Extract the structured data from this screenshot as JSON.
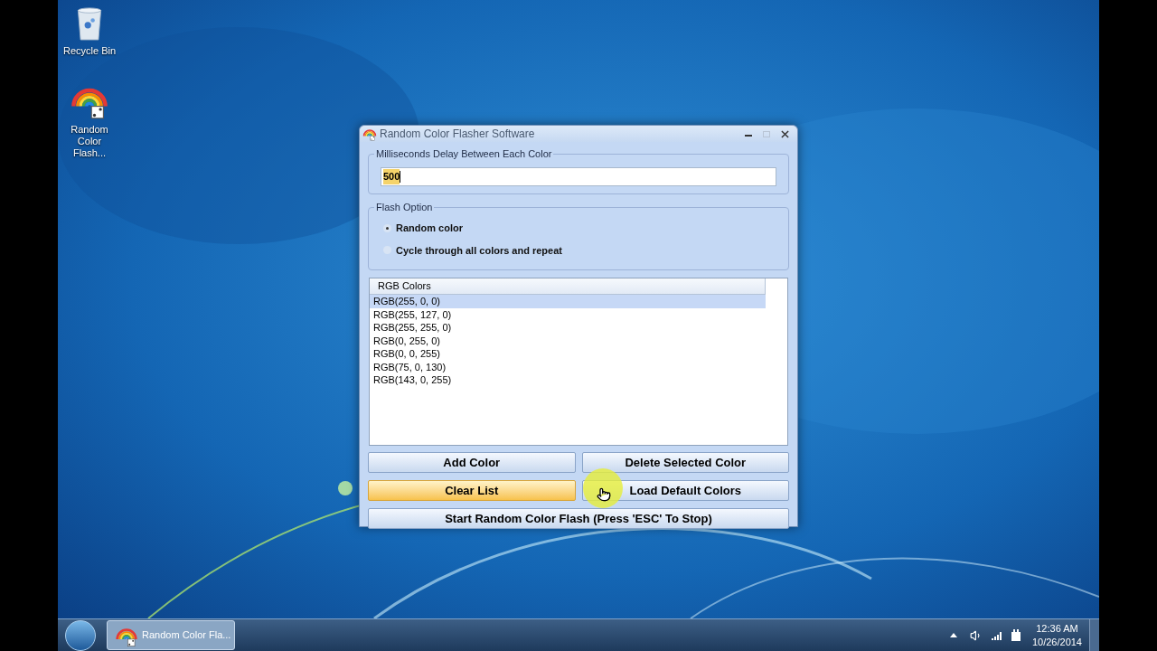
{
  "desktop_icons": [
    {
      "label": "Recycle Bin",
      "kind": "recycle"
    },
    {
      "label": "Random Color Flash...",
      "kind": "app"
    }
  ],
  "window": {
    "title": "Random Color Flasher Software",
    "delay_group": {
      "legend": "Milliseconds Delay Between Each Color",
      "value": "500"
    },
    "flash_option": {
      "legend": "Flash Option",
      "options": [
        {
          "label": "Random color",
          "selected": true
        },
        {
          "label": "Cycle through all colors and repeat",
          "selected": false
        }
      ]
    },
    "list": {
      "column": "RGB Colors",
      "rows": [
        {
          "text": "RGB(255, 0, 0)",
          "selected": true
        },
        {
          "text": "RGB(255, 127, 0)",
          "selected": false
        },
        {
          "text": "RGB(255, 255, 0)",
          "selected": false
        },
        {
          "text": "RGB(0, 255, 0)",
          "selected": false
        },
        {
          "text": "RGB(0, 0, 255)",
          "selected": false
        },
        {
          "text": "RGB(75, 0, 130)",
          "selected": false
        },
        {
          "text": "RGB(143, 0, 255)",
          "selected": false
        }
      ]
    },
    "buttons": [
      {
        "label": "Add Color",
        "hovered": false
      },
      {
        "label": "Delete Selected Color",
        "hovered": false
      },
      {
        "label": "Clear List",
        "hovered": true
      },
      {
        "label": "Load Default Colors",
        "hovered": false
      },
      {
        "label": "Start Random Color Flash (Press 'ESC' To Stop)",
        "hovered": false
      }
    ]
  },
  "taskbar": {
    "tasks": [
      {
        "label": "Random Color Fla...",
        "active": true
      }
    ],
    "time": "12:36 AM",
    "date": "10/26/2014"
  }
}
